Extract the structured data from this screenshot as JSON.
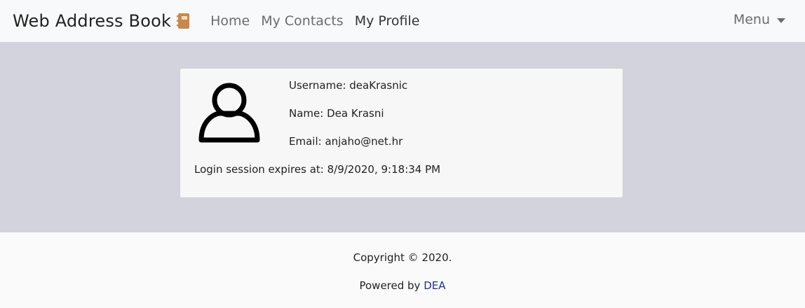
{
  "navbar": {
    "brand": "Web Address Book",
    "brand_icon": "address-book-icon",
    "items": [
      {
        "label": "Home"
      },
      {
        "label": "My Contacts"
      },
      {
        "label": "My Profile"
      }
    ],
    "menu_label": "Menu"
  },
  "profile": {
    "avatar_icon": "user-icon",
    "username": "Username: deaKrasnic",
    "name": "Name: Dea Krasni",
    "email": "Email: anjaho@net.hr",
    "session": "Login session expires at: 8/9/2020, 9:18:34 PM"
  },
  "footer": {
    "copyright": "Copyright © 2020.",
    "powered_prefix": "Powered by ",
    "powered_link": "DEA"
  },
  "colors": {
    "brand_icon": "#c8874e",
    "main_bg": "#d3d3de",
    "link": "#1f2fa0"
  }
}
